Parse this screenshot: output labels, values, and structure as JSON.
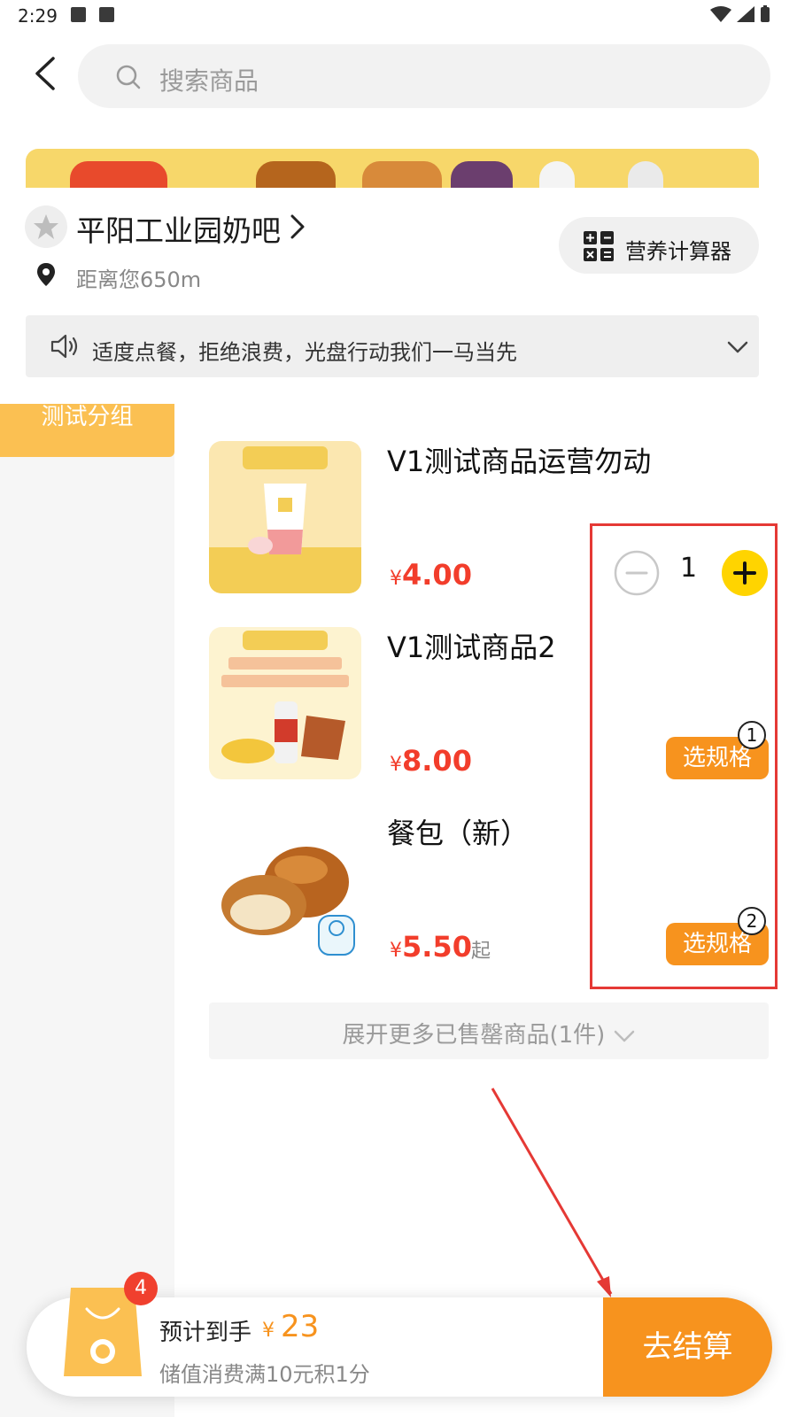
{
  "status_bar": {
    "time": "2:29"
  },
  "search": {
    "placeholder": "搜索商品"
  },
  "shop": {
    "name": "平阳工业园奶吧",
    "distance": "距离您650m",
    "calculator_label": "营养计算器"
  },
  "notice": {
    "text": "适度点餐，拒绝浪费，光盘行动我们一马当先"
  },
  "categories": [
    {
      "label": "测试分组",
      "active": true
    }
  ],
  "products": [
    {
      "name": "V1测试商品运营勿动",
      "currency": "¥",
      "price": "4.00",
      "quantity": "1",
      "action": "stepper"
    },
    {
      "name": "V1测试商品2",
      "currency": "¥",
      "price": "8.00",
      "action_label": "选规格",
      "marker": "1"
    },
    {
      "name": "餐包（新）",
      "currency": "¥",
      "price": "5.50",
      "price_suffix": "起",
      "action_label": "选规格",
      "marker": "2"
    }
  ],
  "soldout": {
    "label": "展开更多已售罄商品(1件)"
  },
  "cart": {
    "badge": "4",
    "estimate_label": "预计到手",
    "currency": "¥",
    "estimate_value": "23",
    "points_text": "储值消费满10元积1分",
    "checkout_label": "去结算"
  },
  "colors": {
    "accent": "#f7931e",
    "price": "#f23d2b",
    "stepper_plus": "#ffd400",
    "annotation": "#e53935",
    "category_active": "#fbc052"
  }
}
